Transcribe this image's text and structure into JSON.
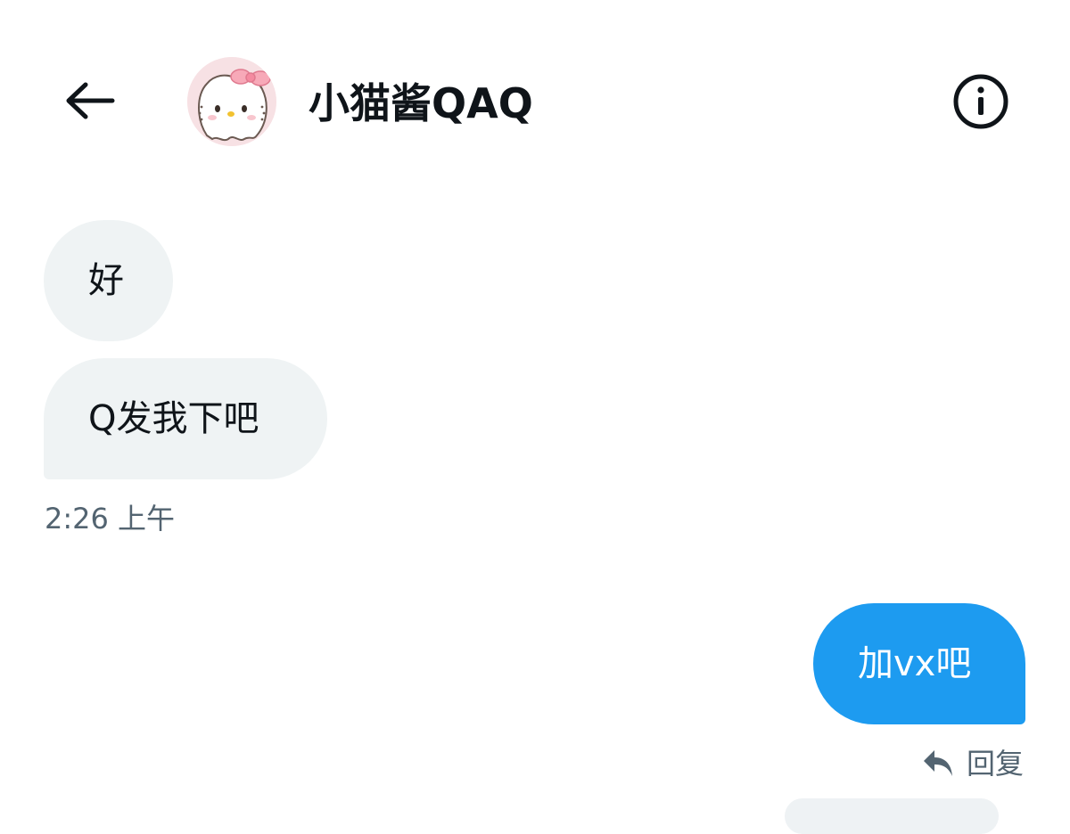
{
  "header": {
    "contact_name": "小猫酱QAQ",
    "back_icon": "arrow-left-icon",
    "info_icon": "info-circle-icon",
    "avatar_icon": "hello-kitty-avatar"
  },
  "messages": [
    {
      "direction": "incoming",
      "text": "好"
    },
    {
      "direction": "incoming",
      "text": "Q发我下吧"
    },
    {
      "direction": "outgoing",
      "text": "加vx吧"
    }
  ],
  "incoming_timestamp": "2:26 上午",
  "reply_action": {
    "label": "回复",
    "icon": "reply-arrow-icon"
  },
  "colors": {
    "outgoing_bubble": "#1d9bf0",
    "incoming_bubble": "#eff3f4",
    "secondary_text": "#536471",
    "primary_text": "#0f1419"
  }
}
